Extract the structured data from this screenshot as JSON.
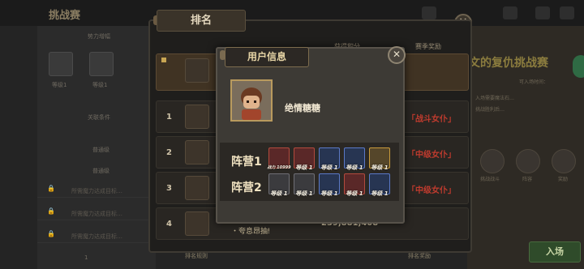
{
  "background": {
    "title": "挑战赛",
    "left_labels": [
      "势力增幅",
      "等级1",
      "等级1",
      "关联条件",
      "普通级",
      "普通级"
    ],
    "left_rows": [
      "所需魔力达成目标…",
      "所需魔力达成目标…",
      "所需魔力达成目标…"
    ],
    "right_title": "文的复仇挑战赛",
    "right_small": [
      "可入场时间：",
      "入场需要魔法石…",
      "挑战胜利后…"
    ],
    "right_icons": [
      "挑战战斗",
      "阵容",
      "队伍",
      "奖励"
    ],
    "enter_button": "入场",
    "bottom_count": "1"
  },
  "rankings": {
    "tab_label": "排名",
    "col_score": "获得积分",
    "col_reward": "赛季奖励",
    "rows": [
      {
        "rank": "1",
        "reward": "「战斗女仆」"
      },
      {
        "rank": "2",
        "reward": "「中级女仆」"
      },
      {
        "rank": "3",
        "reward": "「中级女仆」"
      },
      {
        "rank": "4",
        "name": "・夸息昂抽ǃ",
        "score": "239,881,408"
      }
    ],
    "bottom_left": "排名规则",
    "bottom_right": "排名奖励"
  },
  "user_info": {
    "tab_label": "用户信息",
    "close_icon": "close-icon",
    "username": "绝情糖糖",
    "teams": [
      {
        "label": "阵营1",
        "heroes": [
          {
            "level": "战力 10999",
            "color": "red"
          },
          {
            "level": "等级 1",
            "color": "red"
          },
          {
            "level": "等级 1",
            "color": "blue"
          },
          {
            "level": "等级 1",
            "color": "blue"
          },
          {
            "level": "等级 1",
            "color": "gold"
          }
        ]
      },
      {
        "label": "阵营2",
        "heroes": [
          {
            "level": "等级 1",
            "color": "grey"
          },
          {
            "level": "等级 1",
            "color": "grey"
          },
          {
            "level": "等级 1",
            "color": "blue"
          },
          {
            "level": "等级 1",
            "color": "red"
          },
          {
            "level": "等级 1",
            "color": "blue"
          }
        ]
      }
    ]
  },
  "colors": {
    "accent_gold": "#c9a653",
    "reward_red": "#c03b2e",
    "panel_dark": "#1f1e1c"
  }
}
